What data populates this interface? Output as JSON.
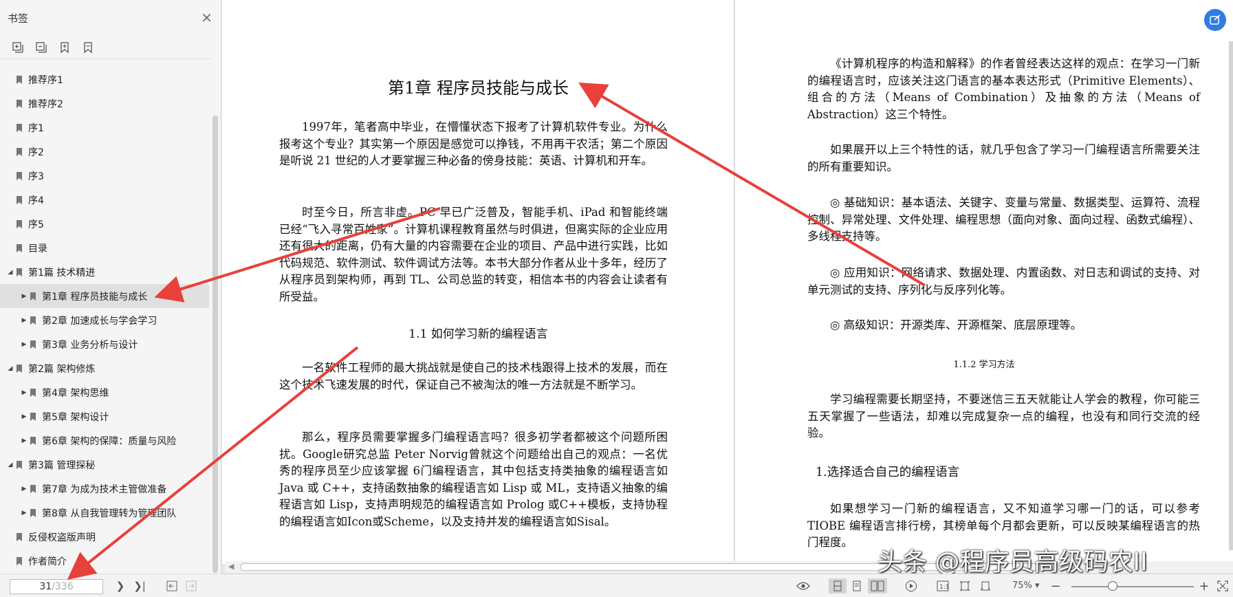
{
  "sidebar": {
    "title": "书签",
    "items": [
      {
        "label": "推荐序1",
        "level": 0,
        "toggle": "",
        "selected": false
      },
      {
        "label": "推荐序2",
        "level": 0,
        "toggle": "",
        "selected": false
      },
      {
        "label": "序1",
        "level": 0,
        "toggle": "",
        "selected": false
      },
      {
        "label": "序2",
        "level": 0,
        "toggle": "",
        "selected": false
      },
      {
        "label": "序3",
        "level": 0,
        "toggle": "",
        "selected": false
      },
      {
        "label": "序4",
        "level": 0,
        "toggle": "",
        "selected": false
      },
      {
        "label": "序5",
        "level": 0,
        "toggle": "",
        "selected": false
      },
      {
        "label": "目录",
        "level": 0,
        "toggle": "",
        "selected": false
      },
      {
        "label": "第1篇 技术精进",
        "level": 0,
        "toggle": "expanded",
        "selected": false
      },
      {
        "label": "第1章 程序员技能与成长",
        "level": 1,
        "toggle": "collapsed",
        "selected": true
      },
      {
        "label": "第2章 加速成长与学会学习",
        "level": 1,
        "toggle": "collapsed",
        "selected": false
      },
      {
        "label": "第3章 业务分析与设计",
        "level": 1,
        "toggle": "collapsed",
        "selected": false
      },
      {
        "label": "第2篇 架构修炼",
        "level": 0,
        "toggle": "expanded",
        "selected": false
      },
      {
        "label": "第4章 架构思维",
        "level": 1,
        "toggle": "collapsed",
        "selected": false
      },
      {
        "label": "第5章 架构设计",
        "level": 1,
        "toggle": "collapsed",
        "selected": false
      },
      {
        "label": "第6章 架构的保障：质量与风险",
        "level": 1,
        "toggle": "collapsed",
        "selected": false
      },
      {
        "label": "第3篇 管理探秘",
        "level": 0,
        "toggle": "expanded",
        "selected": false
      },
      {
        "label": "第7章 为成为技术主管做准备",
        "level": 1,
        "toggle": "collapsed",
        "selected": false
      },
      {
        "label": "第8章 从自我管理转为管理团队",
        "level": 1,
        "toggle": "collapsed",
        "selected": false
      },
      {
        "label": "反侵权盗版声明",
        "level": 0,
        "toggle": "",
        "selected": false
      },
      {
        "label": "作者简介",
        "level": 0,
        "toggle": "",
        "selected": false
      }
    ]
  },
  "left_page": {
    "chapter_title": "第1章  程序员技能与成长",
    "p1": "1997年，笔者高中毕业，在懵懂状态下报考了计算机软件专业。为什么报考这个专业？其实第一个原因是感觉可以挣钱，不用再干农活；第二个原因是听说 21 世纪的人才要掌握三种必备的傍身技能：英语、计算机和开车。",
    "p2": "时至今日，所言非虚。PC 早已广泛普及，智能手机、iPad 和智能终端已经“飞入寻常百姓家”。计算机课程教育虽然与时俱进，但离实际的企业应用还有很大的距离，仍有大量的内容需要在企业的项目、产品中进行实践，比如代码规范、软件测试、软件调试方法等。本书大部分作者从业十多年，经历了从程序员到架构师，再到 TL、公司总监的转变，相信本书的内容会让读者有所受益。",
    "section_title": "1.1  如何学习新的编程语言",
    "p3": "一名软件工程师的最大挑战就是使自己的技术栈跟得上技术的发展，而在这个技术飞速发展的时代，保证自己不被淘汰的唯一方法就是不断学习。",
    "p4": "那么，程序员需要掌握多门编程语言吗？很多初学者都被这个问题所困扰。Google研究总监 Peter Norvig曾就这个问题给出自己的观点：一名优秀的程序员至少应该掌握 6门编程语言，其中包括支持类抽象的编程语言如 Java 或 C++，支持函数抽象的编程语言如 Lisp 或 ML，支持语义抽象的编程语言如 Lisp，支持声明规范的编程语言如 Prolog 或C++模板，支持协程的编程语言如Icon或Scheme，以及支持并发的编程语言如Sisal。"
  },
  "right_page": {
    "p1": "《计算机程序的构造和解释》的作者曾经表达这样的观点：在学习一门新的编程语言时，应该关注这门语言的基本表达形式（Primitive Elements）、组合的方法（Means of Combination）及抽象的方法（Means of Abstraction）这三个特性。",
    "p2": "如果展开以上三个特性的话，就几乎包含了学习一门编程语言所需要关注的所有重要知识。",
    "p3": "◎ 基础知识：基本语法、关键字、变量与常量、数据类型、运算符、流程控制、异常处理、文件处理、编程思想（面向对象、面向过程、函数式编程）、多线程支持等。",
    "p4": "◎ 应用知识：网络请求、数据处理、内置函数、对日志和调试的支持、对单元测试的支持、序列化与反序列化等。",
    "p5": "◎ 高级知识：开源类库、开源框架、底层原理等。",
    "subsection_title": "1.1.2  学习方法",
    "p6": "学习编程需要长期坚持，不要迷信三五天就能让人学会的教程，你可能三五天掌握了一些语法，却难以完成复杂一点的编程，也没有和同行交流的经验。",
    "heading": "1.选择适合自己的编程语言",
    "p7": "如果想学习一门新的编程语言，又不知道学习哪一门的话，可以参考 TIOBE 编程语言排行榜，其榜单每个月都会更新，可以反映某编程语言的热门程度。"
  },
  "watermark": "头条 @程序员高级码农II",
  "statusbar": {
    "page_current": "31",
    "page_total": "/336",
    "zoom": "75%"
  },
  "colors": {
    "accent": "#2f7de1",
    "arrow": "#e8403a"
  }
}
